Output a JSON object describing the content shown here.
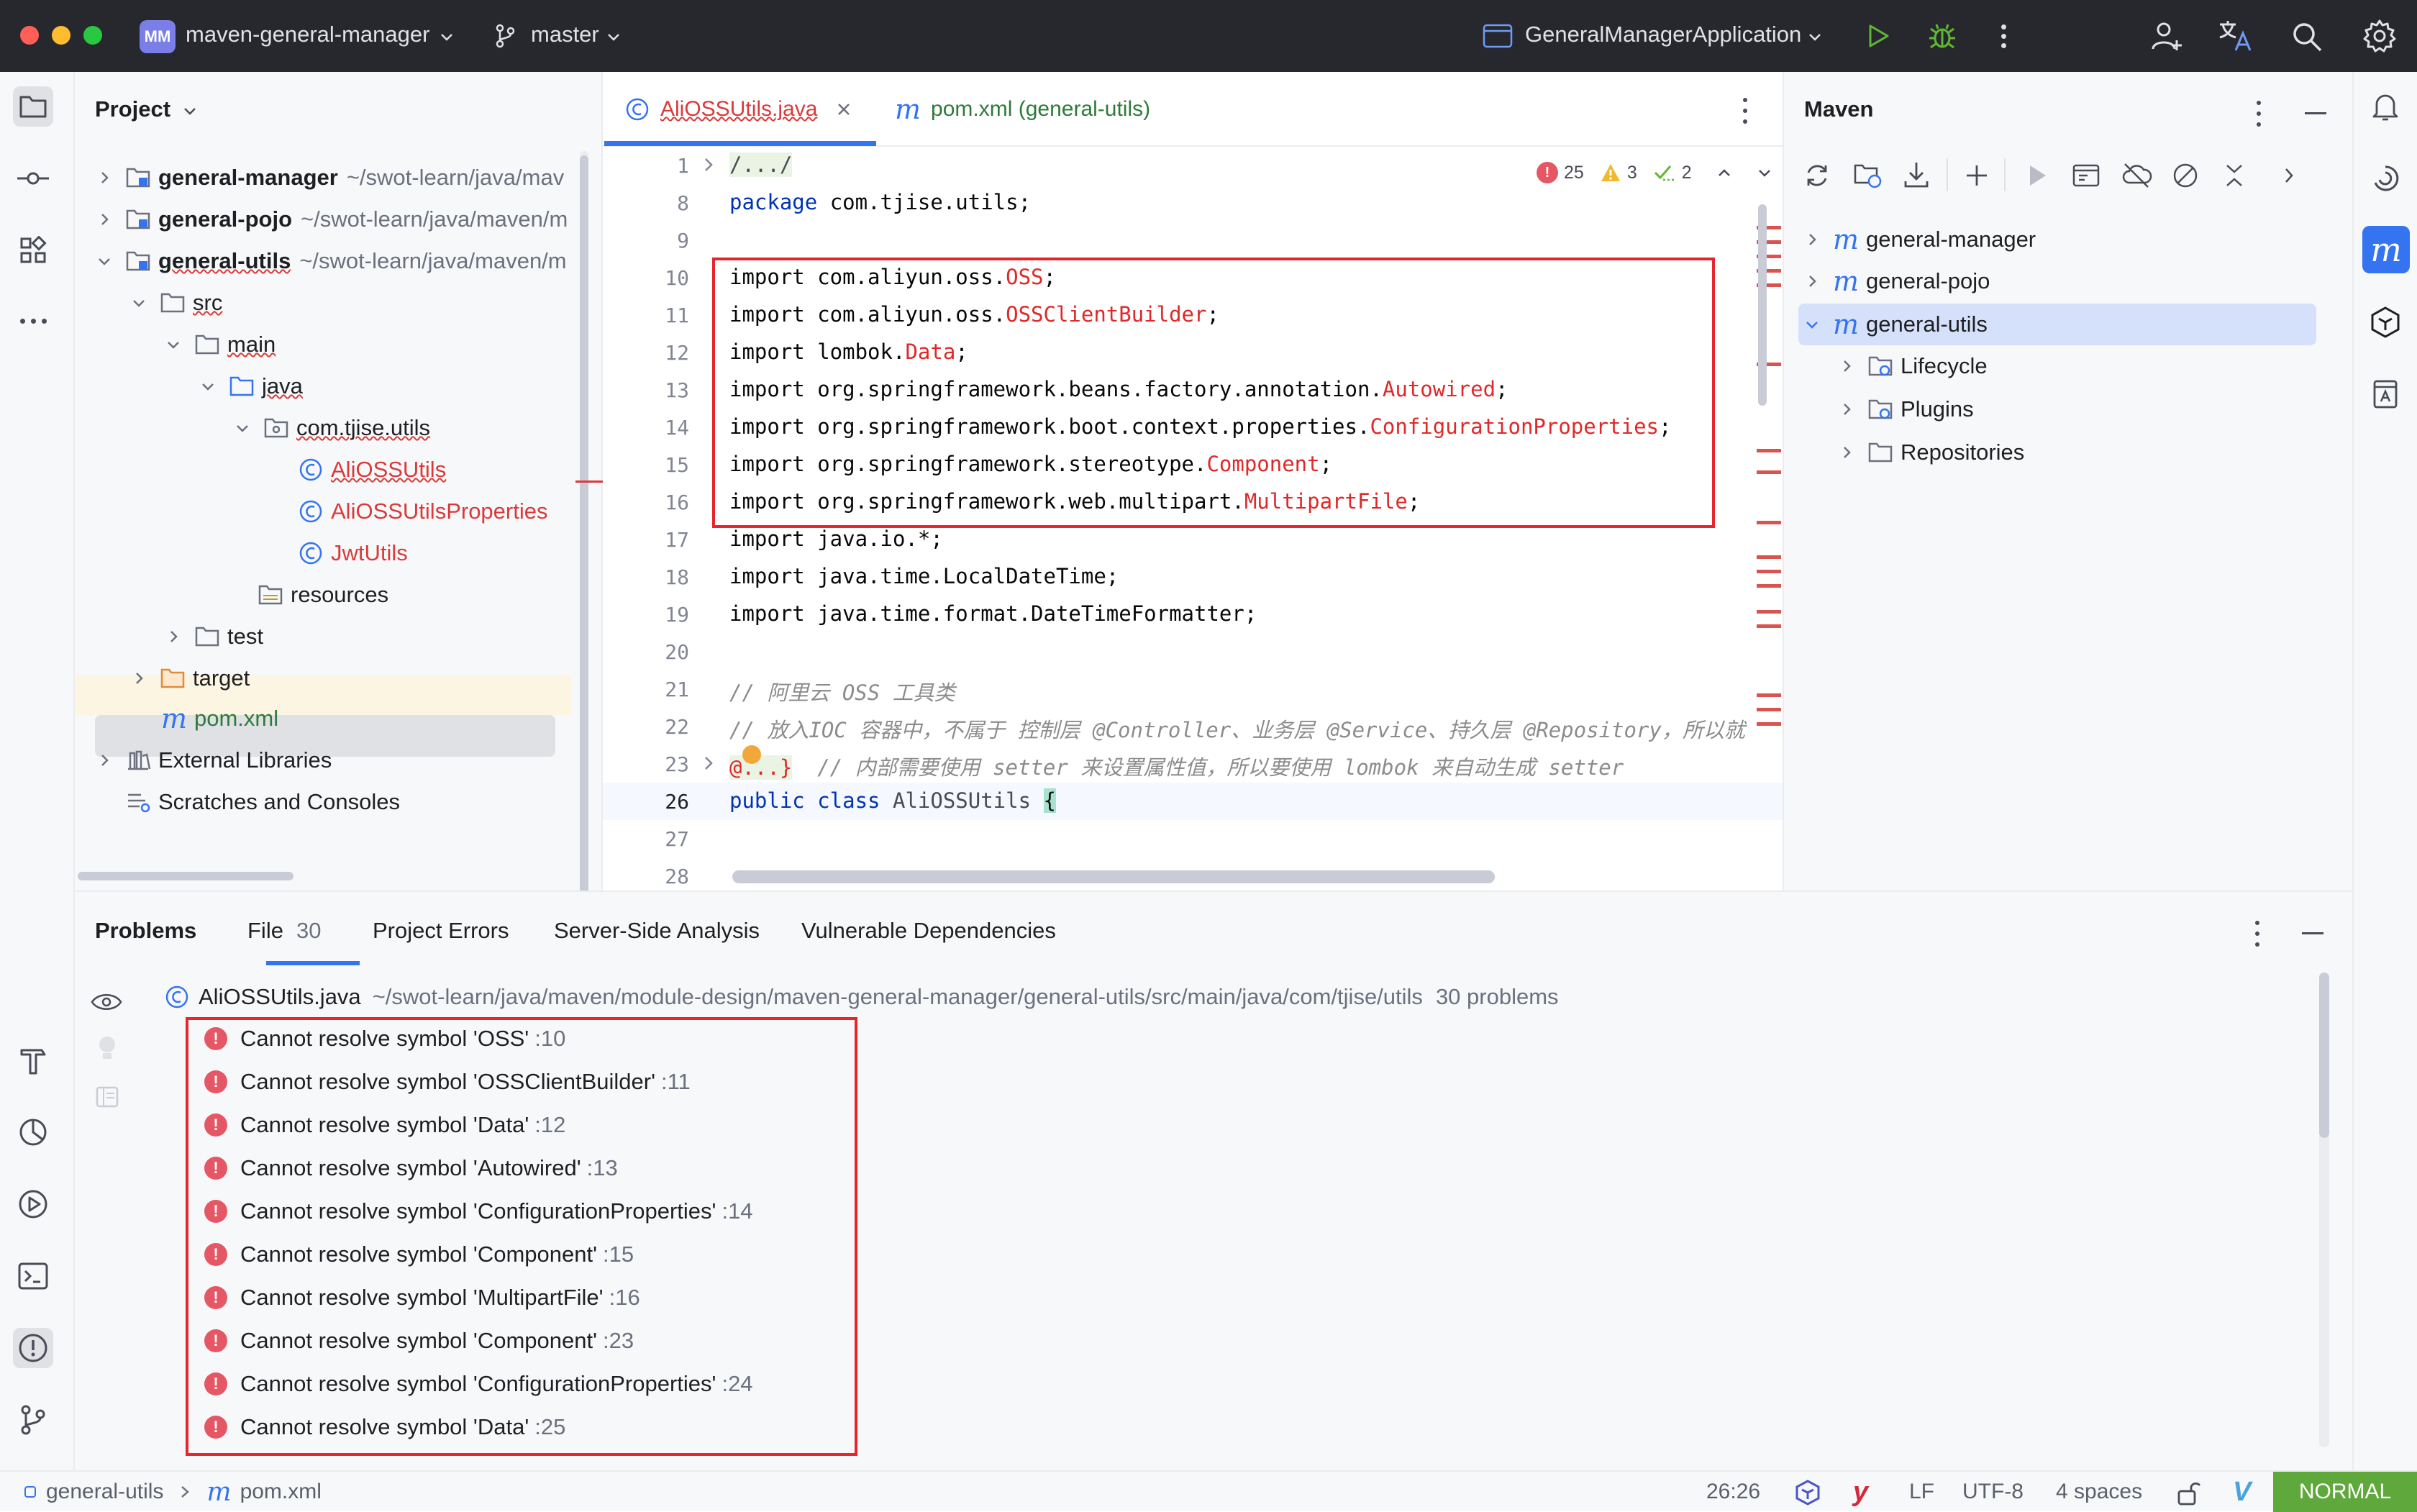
{
  "title_bar": {
    "project_badge": "MM",
    "project_name": "maven-general-manager",
    "branch": "master",
    "run_config": "GeneralManagerApplication"
  },
  "project_panel": {
    "title": "Project",
    "tree": [
      {
        "label": "general-manager",
        "path": "~/swot-learn/java/mav",
        "type": "module"
      },
      {
        "label": "general-pojo",
        "path": "~/swot-learn/java/maven/m",
        "type": "module"
      },
      {
        "label": "general-utils",
        "path": "~/swot-learn/java/maven/m",
        "type": "module"
      },
      {
        "label": "src",
        "type": "folder"
      },
      {
        "label": "main",
        "type": "folder"
      },
      {
        "label": "java",
        "type": "folder"
      },
      {
        "label": "com.tjise.utils",
        "type": "package"
      },
      {
        "label": "AliOSSUtils",
        "type": "class"
      },
      {
        "label": "AliOSSUtilsProperties",
        "type": "class"
      },
      {
        "label": "JwtUtils",
        "type": "class"
      },
      {
        "label": "resources",
        "type": "folder"
      },
      {
        "label": "test",
        "type": "folder"
      },
      {
        "label": "target",
        "type": "folder"
      },
      {
        "label": "pom.xml",
        "type": "maven"
      },
      {
        "label": "External Libraries",
        "type": "libraries"
      },
      {
        "label": "Scratches and Consoles",
        "type": "scratches"
      }
    ]
  },
  "editor": {
    "tabs": [
      {
        "label": "AliOSSUtils.java",
        "active": true
      },
      {
        "label": "pom.xml (general-utils)",
        "active": false
      }
    ],
    "inspections": {
      "errors": "25",
      "warnings": "3",
      "weak": "2"
    },
    "lines": [
      {
        "n": "1",
        "text": "/.../"
      },
      {
        "n": "8",
        "text": "package com.tjise.utils;"
      },
      {
        "n": "9",
        "text": ""
      },
      {
        "n": "10",
        "pre": "import com.aliyun.oss.",
        "err": "OSS",
        "post": ";"
      },
      {
        "n": "11",
        "pre": "import com.aliyun.oss.",
        "err": "OSSClientBuilder",
        "post": ";"
      },
      {
        "n": "12",
        "pre": "import lombok.",
        "err": "Data",
        "post": ";"
      },
      {
        "n": "13",
        "pre": "import org.springframework.beans.factory.annotation.",
        "err": "Autowired",
        "post": ";"
      },
      {
        "n": "14",
        "pre": "import org.springframework.boot.context.properties.",
        "err": "ConfigurationProperties",
        "post": ";"
      },
      {
        "n": "15",
        "pre": "import org.springframework.stereotype.",
        "err": "Component",
        "post": ";"
      },
      {
        "n": "16",
        "pre": "import org.springframework.web.multipart.",
        "err": "MultipartFile",
        "post": ";"
      },
      {
        "n": "17",
        "text": "import java.io.*;"
      },
      {
        "n": "18",
        "text": "import java.time.LocalDateTime;"
      },
      {
        "n": "19",
        "text": "import java.time.format.DateTimeFormatter;"
      },
      {
        "n": "20",
        "text": ""
      },
      {
        "n": "21",
        "comment": "// 阿里云 OSS 工具类"
      },
      {
        "n": "22",
        "comment": "// 放入IOC 容器中，不属于 控制层 @Controller、业务层 @Service、持久层 @Repository，所以就"
      },
      {
        "n": "23",
        "fold": "@...}",
        "comment": "  // 内部需要使用 setter 来设置属性值，所以要使用 lombok 来自动生成 setter"
      },
      {
        "n": "26",
        "text": "public class AliOSSUtils {"
      },
      {
        "n": "27",
        "text": ""
      },
      {
        "n": "28",
        "text": ""
      }
    ]
  },
  "maven_panel": {
    "title": "Maven",
    "tree": [
      {
        "label": "general-manager"
      },
      {
        "label": "general-pojo"
      },
      {
        "label": "general-utils"
      },
      {
        "label": "Lifecycle"
      },
      {
        "label": "Plugins"
      },
      {
        "label": "Repositories"
      }
    ]
  },
  "problems": {
    "title": "Problems",
    "tabs": [
      {
        "label": "File",
        "count": "30"
      },
      {
        "label": "Project Errors"
      },
      {
        "label": "Server-Side Analysis"
      },
      {
        "label": "Vulnerable Dependencies"
      }
    ],
    "file": {
      "name": "AliOSSUtils.java",
      "path": "~/swot-learn/java/maven/module-design/maven-general-manager/general-utils/src/main/java/com/tjise/utils",
      "count": "30 problems"
    },
    "items": [
      {
        "msg": "Cannot resolve symbol 'OSS'",
        "line": ":10"
      },
      {
        "msg": "Cannot resolve symbol 'OSSClientBuilder'",
        "line": ":11"
      },
      {
        "msg": "Cannot resolve symbol 'Data'",
        "line": ":12"
      },
      {
        "msg": "Cannot resolve symbol 'Autowired'",
        "line": ":13"
      },
      {
        "msg": "Cannot resolve symbol 'ConfigurationProperties'",
        "line": ":14"
      },
      {
        "msg": "Cannot resolve symbol 'Component'",
        "line": ":15"
      },
      {
        "msg": "Cannot resolve symbol 'MultipartFile'",
        "line": ":16"
      },
      {
        "msg": "Cannot resolve symbol 'Component'",
        "line": ":23"
      },
      {
        "msg": "Cannot resolve symbol 'ConfigurationProperties'",
        "line": ":24"
      },
      {
        "msg": "Cannot resolve symbol 'Data'",
        "line": ":25"
      }
    ]
  },
  "status_bar": {
    "crumb_module": "general-utils",
    "crumb_file": "pom.xml",
    "position": "26:26",
    "line_sep": "LF",
    "encoding": "UTF-8",
    "indent": "4 spaces",
    "mode": "NORMAL"
  },
  "colors": {
    "error": "#e02828",
    "highlight_box": "#e8252c",
    "mode_badge": "#5fa83b",
    "maven_accent": "#3574f0"
  }
}
